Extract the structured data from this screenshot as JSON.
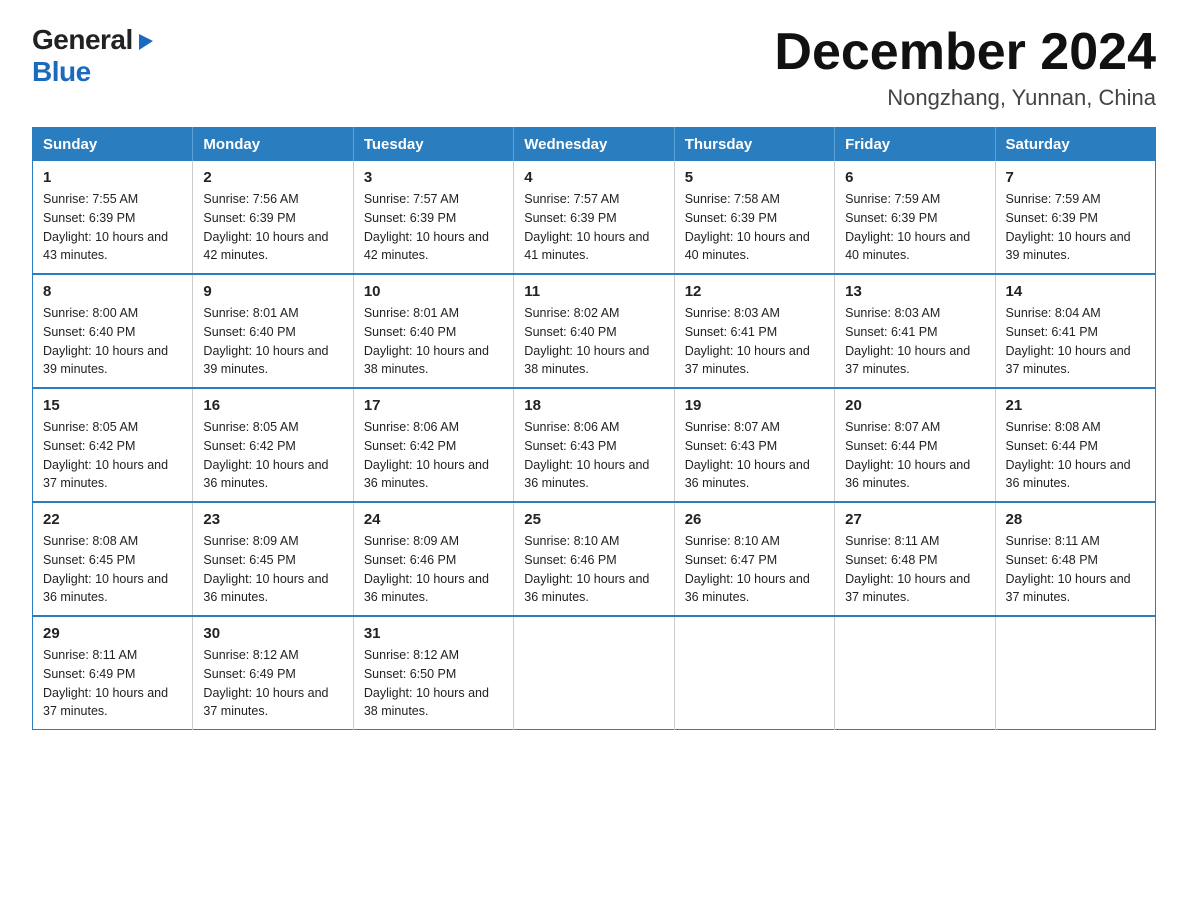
{
  "logo": {
    "general": "General",
    "blue": "Blue",
    "arrow": "▶"
  },
  "title": "December 2024",
  "subtitle": "Nongzhang, Yunnan, China",
  "weekdays": [
    "Sunday",
    "Monday",
    "Tuesday",
    "Wednesday",
    "Thursday",
    "Friday",
    "Saturday"
  ],
  "weeks": [
    [
      {
        "day": "1",
        "sunrise": "7:55 AM",
        "sunset": "6:39 PM",
        "daylight": "10 hours and 43 minutes."
      },
      {
        "day": "2",
        "sunrise": "7:56 AM",
        "sunset": "6:39 PM",
        "daylight": "10 hours and 42 minutes."
      },
      {
        "day": "3",
        "sunrise": "7:57 AM",
        "sunset": "6:39 PM",
        "daylight": "10 hours and 42 minutes."
      },
      {
        "day": "4",
        "sunrise": "7:57 AM",
        "sunset": "6:39 PM",
        "daylight": "10 hours and 41 minutes."
      },
      {
        "day": "5",
        "sunrise": "7:58 AM",
        "sunset": "6:39 PM",
        "daylight": "10 hours and 40 minutes."
      },
      {
        "day": "6",
        "sunrise": "7:59 AM",
        "sunset": "6:39 PM",
        "daylight": "10 hours and 40 minutes."
      },
      {
        "day": "7",
        "sunrise": "7:59 AM",
        "sunset": "6:39 PM",
        "daylight": "10 hours and 39 minutes."
      }
    ],
    [
      {
        "day": "8",
        "sunrise": "8:00 AM",
        "sunset": "6:40 PM",
        "daylight": "10 hours and 39 minutes."
      },
      {
        "day": "9",
        "sunrise": "8:01 AM",
        "sunset": "6:40 PM",
        "daylight": "10 hours and 39 minutes."
      },
      {
        "day": "10",
        "sunrise": "8:01 AM",
        "sunset": "6:40 PM",
        "daylight": "10 hours and 38 minutes."
      },
      {
        "day": "11",
        "sunrise": "8:02 AM",
        "sunset": "6:40 PM",
        "daylight": "10 hours and 38 minutes."
      },
      {
        "day": "12",
        "sunrise": "8:03 AM",
        "sunset": "6:41 PM",
        "daylight": "10 hours and 37 minutes."
      },
      {
        "day": "13",
        "sunrise": "8:03 AM",
        "sunset": "6:41 PM",
        "daylight": "10 hours and 37 minutes."
      },
      {
        "day": "14",
        "sunrise": "8:04 AM",
        "sunset": "6:41 PM",
        "daylight": "10 hours and 37 minutes."
      }
    ],
    [
      {
        "day": "15",
        "sunrise": "8:05 AM",
        "sunset": "6:42 PM",
        "daylight": "10 hours and 37 minutes."
      },
      {
        "day": "16",
        "sunrise": "8:05 AM",
        "sunset": "6:42 PM",
        "daylight": "10 hours and 36 minutes."
      },
      {
        "day": "17",
        "sunrise": "8:06 AM",
        "sunset": "6:42 PM",
        "daylight": "10 hours and 36 minutes."
      },
      {
        "day": "18",
        "sunrise": "8:06 AM",
        "sunset": "6:43 PM",
        "daylight": "10 hours and 36 minutes."
      },
      {
        "day": "19",
        "sunrise": "8:07 AM",
        "sunset": "6:43 PM",
        "daylight": "10 hours and 36 minutes."
      },
      {
        "day": "20",
        "sunrise": "8:07 AM",
        "sunset": "6:44 PM",
        "daylight": "10 hours and 36 minutes."
      },
      {
        "day": "21",
        "sunrise": "8:08 AM",
        "sunset": "6:44 PM",
        "daylight": "10 hours and 36 minutes."
      }
    ],
    [
      {
        "day": "22",
        "sunrise": "8:08 AM",
        "sunset": "6:45 PM",
        "daylight": "10 hours and 36 minutes."
      },
      {
        "day": "23",
        "sunrise": "8:09 AM",
        "sunset": "6:45 PM",
        "daylight": "10 hours and 36 minutes."
      },
      {
        "day": "24",
        "sunrise": "8:09 AM",
        "sunset": "6:46 PM",
        "daylight": "10 hours and 36 minutes."
      },
      {
        "day": "25",
        "sunrise": "8:10 AM",
        "sunset": "6:46 PM",
        "daylight": "10 hours and 36 minutes."
      },
      {
        "day": "26",
        "sunrise": "8:10 AM",
        "sunset": "6:47 PM",
        "daylight": "10 hours and 36 minutes."
      },
      {
        "day": "27",
        "sunrise": "8:11 AM",
        "sunset": "6:48 PM",
        "daylight": "10 hours and 37 minutes."
      },
      {
        "day": "28",
        "sunrise": "8:11 AM",
        "sunset": "6:48 PM",
        "daylight": "10 hours and 37 minutes."
      }
    ],
    [
      {
        "day": "29",
        "sunrise": "8:11 AM",
        "sunset": "6:49 PM",
        "daylight": "10 hours and 37 minutes."
      },
      {
        "day": "30",
        "sunrise": "8:12 AM",
        "sunset": "6:49 PM",
        "daylight": "10 hours and 37 minutes."
      },
      {
        "day": "31",
        "sunrise": "8:12 AM",
        "sunset": "6:50 PM",
        "daylight": "10 hours and 38 minutes."
      },
      null,
      null,
      null,
      null
    ]
  ]
}
